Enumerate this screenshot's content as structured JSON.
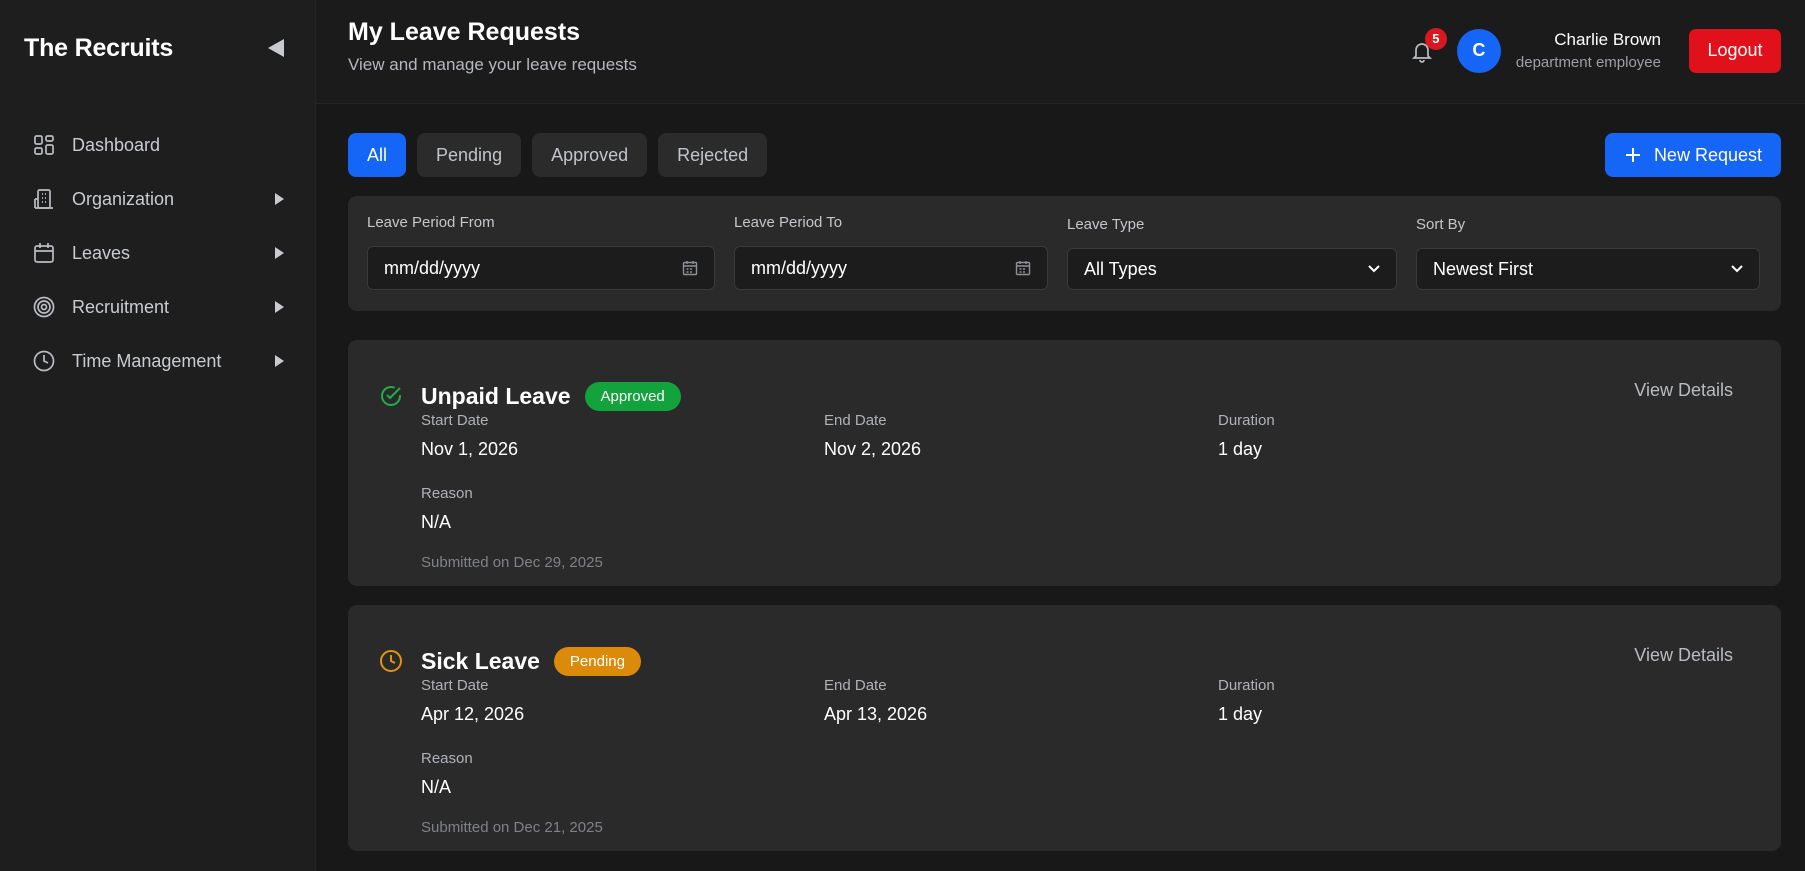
{
  "sidebar": {
    "brand": "The Recruits",
    "items": [
      {
        "label": "Dashboard",
        "icon": "grid-icon",
        "has_arrow": false
      },
      {
        "label": "Organization",
        "icon": "building-icon",
        "has_arrow": true
      },
      {
        "label": "Leaves",
        "icon": "calendar-icon",
        "has_arrow": true
      },
      {
        "label": "Recruitment",
        "icon": "target-icon",
        "has_arrow": true
      },
      {
        "label": "Time Management",
        "icon": "clock-icon",
        "has_arrow": true
      }
    ]
  },
  "header": {
    "title": "My Leave Requests",
    "subtitle": "View and manage your leave requests",
    "notification_count": "5",
    "avatar_initial": "C",
    "user_name": "Charlie Brown",
    "user_role": "department employee",
    "logout_label": "Logout"
  },
  "tabs": [
    {
      "label": "All",
      "active": true
    },
    {
      "label": "Pending",
      "active": false
    },
    {
      "label": "Approved",
      "active": false
    },
    {
      "label": "Rejected",
      "active": false
    }
  ],
  "new_request_label": "New Request",
  "filters": {
    "from_label": "Leave Period From",
    "from_value": "mm/dd/yyyy",
    "to_label": "Leave Period To",
    "to_value": "mm/dd/yyyy",
    "type_label": "Leave Type",
    "type_value": "All Types",
    "sort_label": "Sort By",
    "sort_value": "Newest First"
  },
  "requests": [
    {
      "title": "Unpaid Leave",
      "status": "Approved",
      "start_label": "Start Date",
      "start": "Nov 1, 2026",
      "end_label": "End Date",
      "end": "Nov 2, 2026",
      "duration_label": "Duration",
      "duration": "1 day",
      "reason_label": "Reason",
      "reason": "N/A",
      "submitted": "Submitted on Dec 29, 2025",
      "view_label": "View Details"
    },
    {
      "title": "Sick Leave",
      "status": "Pending",
      "start_label": "Start Date",
      "start": "Apr 12, 2026",
      "end_label": "End Date",
      "end": "Apr 13, 2026",
      "duration_label": "Duration",
      "duration": "1 day",
      "reason_label": "Reason",
      "reason": "N/A",
      "submitted": "Submitted on Dec 21, 2025",
      "view_label": "View Details"
    }
  ],
  "colors": {
    "accent": "#1565f6",
    "approved": "#12a33d",
    "pending": "#dc8a0a",
    "danger": "#e0111b"
  }
}
